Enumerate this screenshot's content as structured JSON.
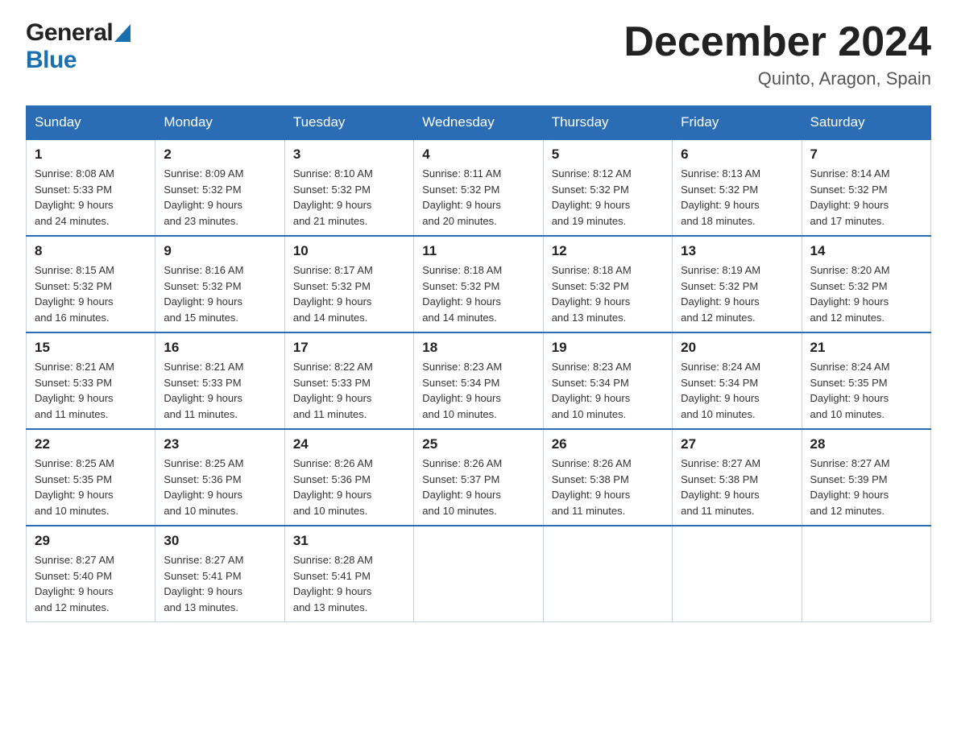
{
  "header": {
    "logo_general": "General",
    "logo_blue": "Blue",
    "month_title": "December 2024",
    "location": "Quinto, Aragon, Spain"
  },
  "weekdays": [
    "Sunday",
    "Monday",
    "Tuesday",
    "Wednesday",
    "Thursday",
    "Friday",
    "Saturday"
  ],
  "weeks": [
    [
      {
        "day": "1",
        "sunrise": "Sunrise: 8:08 AM",
        "sunset": "Sunset: 5:33 PM",
        "daylight": "Daylight: 9 hours",
        "daylight2": "and 24 minutes."
      },
      {
        "day": "2",
        "sunrise": "Sunrise: 8:09 AM",
        "sunset": "Sunset: 5:32 PM",
        "daylight": "Daylight: 9 hours",
        "daylight2": "and 23 minutes."
      },
      {
        "day": "3",
        "sunrise": "Sunrise: 8:10 AM",
        "sunset": "Sunset: 5:32 PM",
        "daylight": "Daylight: 9 hours",
        "daylight2": "and 21 minutes."
      },
      {
        "day": "4",
        "sunrise": "Sunrise: 8:11 AM",
        "sunset": "Sunset: 5:32 PM",
        "daylight": "Daylight: 9 hours",
        "daylight2": "and 20 minutes."
      },
      {
        "day": "5",
        "sunrise": "Sunrise: 8:12 AM",
        "sunset": "Sunset: 5:32 PM",
        "daylight": "Daylight: 9 hours",
        "daylight2": "and 19 minutes."
      },
      {
        "day": "6",
        "sunrise": "Sunrise: 8:13 AM",
        "sunset": "Sunset: 5:32 PM",
        "daylight": "Daylight: 9 hours",
        "daylight2": "and 18 minutes."
      },
      {
        "day": "7",
        "sunrise": "Sunrise: 8:14 AM",
        "sunset": "Sunset: 5:32 PM",
        "daylight": "Daylight: 9 hours",
        "daylight2": "and 17 minutes."
      }
    ],
    [
      {
        "day": "8",
        "sunrise": "Sunrise: 8:15 AM",
        "sunset": "Sunset: 5:32 PM",
        "daylight": "Daylight: 9 hours",
        "daylight2": "and 16 minutes."
      },
      {
        "day": "9",
        "sunrise": "Sunrise: 8:16 AM",
        "sunset": "Sunset: 5:32 PM",
        "daylight": "Daylight: 9 hours",
        "daylight2": "and 15 minutes."
      },
      {
        "day": "10",
        "sunrise": "Sunrise: 8:17 AM",
        "sunset": "Sunset: 5:32 PM",
        "daylight": "Daylight: 9 hours",
        "daylight2": "and 14 minutes."
      },
      {
        "day": "11",
        "sunrise": "Sunrise: 8:18 AM",
        "sunset": "Sunset: 5:32 PM",
        "daylight": "Daylight: 9 hours",
        "daylight2": "and 14 minutes."
      },
      {
        "day": "12",
        "sunrise": "Sunrise: 8:18 AM",
        "sunset": "Sunset: 5:32 PM",
        "daylight": "Daylight: 9 hours",
        "daylight2": "and 13 minutes."
      },
      {
        "day": "13",
        "sunrise": "Sunrise: 8:19 AM",
        "sunset": "Sunset: 5:32 PM",
        "daylight": "Daylight: 9 hours",
        "daylight2": "and 12 minutes."
      },
      {
        "day": "14",
        "sunrise": "Sunrise: 8:20 AM",
        "sunset": "Sunset: 5:32 PM",
        "daylight": "Daylight: 9 hours",
        "daylight2": "and 12 minutes."
      }
    ],
    [
      {
        "day": "15",
        "sunrise": "Sunrise: 8:21 AM",
        "sunset": "Sunset: 5:33 PM",
        "daylight": "Daylight: 9 hours",
        "daylight2": "and 11 minutes."
      },
      {
        "day": "16",
        "sunrise": "Sunrise: 8:21 AM",
        "sunset": "Sunset: 5:33 PM",
        "daylight": "Daylight: 9 hours",
        "daylight2": "and 11 minutes."
      },
      {
        "day": "17",
        "sunrise": "Sunrise: 8:22 AM",
        "sunset": "Sunset: 5:33 PM",
        "daylight": "Daylight: 9 hours",
        "daylight2": "and 11 minutes."
      },
      {
        "day": "18",
        "sunrise": "Sunrise: 8:23 AM",
        "sunset": "Sunset: 5:34 PM",
        "daylight": "Daylight: 9 hours",
        "daylight2": "and 10 minutes."
      },
      {
        "day": "19",
        "sunrise": "Sunrise: 8:23 AM",
        "sunset": "Sunset: 5:34 PM",
        "daylight": "Daylight: 9 hours",
        "daylight2": "and 10 minutes."
      },
      {
        "day": "20",
        "sunrise": "Sunrise: 8:24 AM",
        "sunset": "Sunset: 5:34 PM",
        "daylight": "Daylight: 9 hours",
        "daylight2": "and 10 minutes."
      },
      {
        "day": "21",
        "sunrise": "Sunrise: 8:24 AM",
        "sunset": "Sunset: 5:35 PM",
        "daylight": "Daylight: 9 hours",
        "daylight2": "and 10 minutes."
      }
    ],
    [
      {
        "day": "22",
        "sunrise": "Sunrise: 8:25 AM",
        "sunset": "Sunset: 5:35 PM",
        "daylight": "Daylight: 9 hours",
        "daylight2": "and 10 minutes."
      },
      {
        "day": "23",
        "sunrise": "Sunrise: 8:25 AM",
        "sunset": "Sunset: 5:36 PM",
        "daylight": "Daylight: 9 hours",
        "daylight2": "and 10 minutes."
      },
      {
        "day": "24",
        "sunrise": "Sunrise: 8:26 AM",
        "sunset": "Sunset: 5:36 PM",
        "daylight": "Daylight: 9 hours",
        "daylight2": "and 10 minutes."
      },
      {
        "day": "25",
        "sunrise": "Sunrise: 8:26 AM",
        "sunset": "Sunset: 5:37 PM",
        "daylight": "Daylight: 9 hours",
        "daylight2": "and 10 minutes."
      },
      {
        "day": "26",
        "sunrise": "Sunrise: 8:26 AM",
        "sunset": "Sunset: 5:38 PM",
        "daylight": "Daylight: 9 hours",
        "daylight2": "and 11 minutes."
      },
      {
        "day": "27",
        "sunrise": "Sunrise: 8:27 AM",
        "sunset": "Sunset: 5:38 PM",
        "daylight": "Daylight: 9 hours",
        "daylight2": "and 11 minutes."
      },
      {
        "day": "28",
        "sunrise": "Sunrise: 8:27 AM",
        "sunset": "Sunset: 5:39 PM",
        "daylight": "Daylight: 9 hours",
        "daylight2": "and 12 minutes."
      }
    ],
    [
      {
        "day": "29",
        "sunrise": "Sunrise: 8:27 AM",
        "sunset": "Sunset: 5:40 PM",
        "daylight": "Daylight: 9 hours",
        "daylight2": "and 12 minutes."
      },
      {
        "day": "30",
        "sunrise": "Sunrise: 8:27 AM",
        "sunset": "Sunset: 5:41 PM",
        "daylight": "Daylight: 9 hours",
        "daylight2": "and 13 minutes."
      },
      {
        "day": "31",
        "sunrise": "Sunrise: 8:28 AM",
        "sunset": "Sunset: 5:41 PM",
        "daylight": "Daylight: 9 hours",
        "daylight2": "and 13 minutes."
      },
      null,
      null,
      null,
      null
    ]
  ]
}
